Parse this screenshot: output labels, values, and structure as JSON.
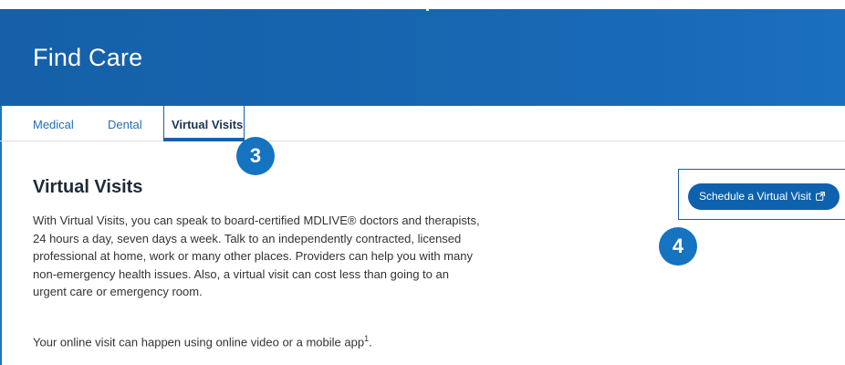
{
  "header": {
    "title": "Find Care"
  },
  "tabs": [
    {
      "label": "Medical",
      "active": false
    },
    {
      "label": "Dental",
      "active": false
    },
    {
      "label": "Virtual Visits",
      "active": true
    }
  ],
  "callouts": {
    "tab_step": "3",
    "button_step": "4"
  },
  "content": {
    "title": "Virtual Visits",
    "description": "With Virtual Visits, you can speak to board-certified MDLIVE® doctors and therapists, 24 hours a day, seven days a week. Talk to an independently contracted, licensed professional at home, work or many other places. Providers can help you with many non-emergency health issues. Also, a virtual visit can cost less than going to an urgent care or emergency room.",
    "online_visit_text": "Your online visit can happen using online video or a mobile app",
    "online_visit_footnote": "1",
    "online_visit_end": "."
  },
  "cta": {
    "label": "Schedule a Virtual Visit",
    "icon": "external-link-icon"
  },
  "colors": {
    "header_bg": "#1766b1",
    "link": "#1f6fb8",
    "badge": "#1573c0",
    "button": "#0e61ad",
    "highlight_border": "#1b5fa8"
  }
}
